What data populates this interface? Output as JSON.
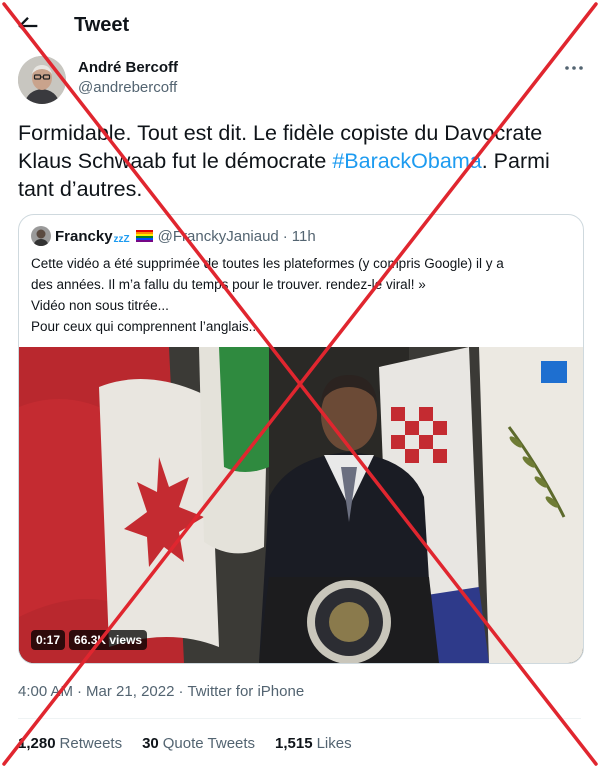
{
  "header": {
    "title": "Tweet",
    "back_icon": "arrow-left-icon"
  },
  "author": {
    "name": "André Bercoff",
    "handle": "@andrebercoff"
  },
  "tweet": {
    "text_before": "Formidable. Tout est dit. Le fidèle copiste du Davocrate Klaus Schwaab fut le démocrate ",
    "hashtag": "#BarackObama",
    "text_after": ". Parmi tant d’autres."
  },
  "quote": {
    "name": "Francky",
    "name_suffix": "zzZ",
    "flag_icon": "rainbow-flag-icon",
    "handle": "@FranckyJaniaud",
    "dot": "·",
    "time": "11h",
    "lines": [
      "Cette vidéo a été supprimée de toutes les plateformes (y compris Google) il y a",
      "des années. Il m’a fallu du temps pour le trouver. rendez-le viral! »",
      "Vidéo non sous titrée...",
      "Pour ceux qui comprennent l’anglais.."
    ],
    "video": {
      "duration": "0:17",
      "views": "66.3K views"
    }
  },
  "meta": {
    "time": "4:00 AM",
    "date": "Mar 21, 2022",
    "source": "Twitter for iPhone",
    "sep": "·"
  },
  "stats": [
    {
      "value": "1,280",
      "label": "Retweets"
    },
    {
      "value": "30",
      "label": "Quote Tweets"
    },
    {
      "value": "1,515",
      "label": "Likes"
    }
  ],
  "colors": {
    "accent": "#1d9bf0",
    "cross": "#e0262f",
    "text": "#0f1419",
    "secondary": "#536471"
  }
}
